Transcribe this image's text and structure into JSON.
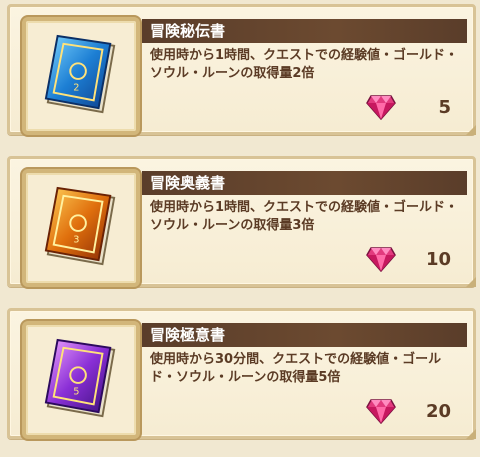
{
  "items": [
    {
      "title": "冒険秘伝書",
      "description": "使用時から1時間、クエストでの経験値・ゴールド・ソウル・ルーンの取得量2倍",
      "price": "5",
      "currency_icon": "gem-icon",
      "book_color": "#1d7fd4"
    },
    {
      "title": "冒険奥義書",
      "description": "使用時から1時間、クエストでの経験値・ゴールド・ソウル・ルーンの取得量3倍",
      "price": "10",
      "currency_icon": "gem-icon",
      "book_color": "#e0700d"
    },
    {
      "title": "冒険極意書",
      "description": "使用時から30分間、クエストでの経験値・ゴールド・ソウル・ルーンの取得量5倍",
      "price": "20",
      "currency_icon": "gem-icon",
      "book_color": "#8a2fd6"
    }
  ]
}
